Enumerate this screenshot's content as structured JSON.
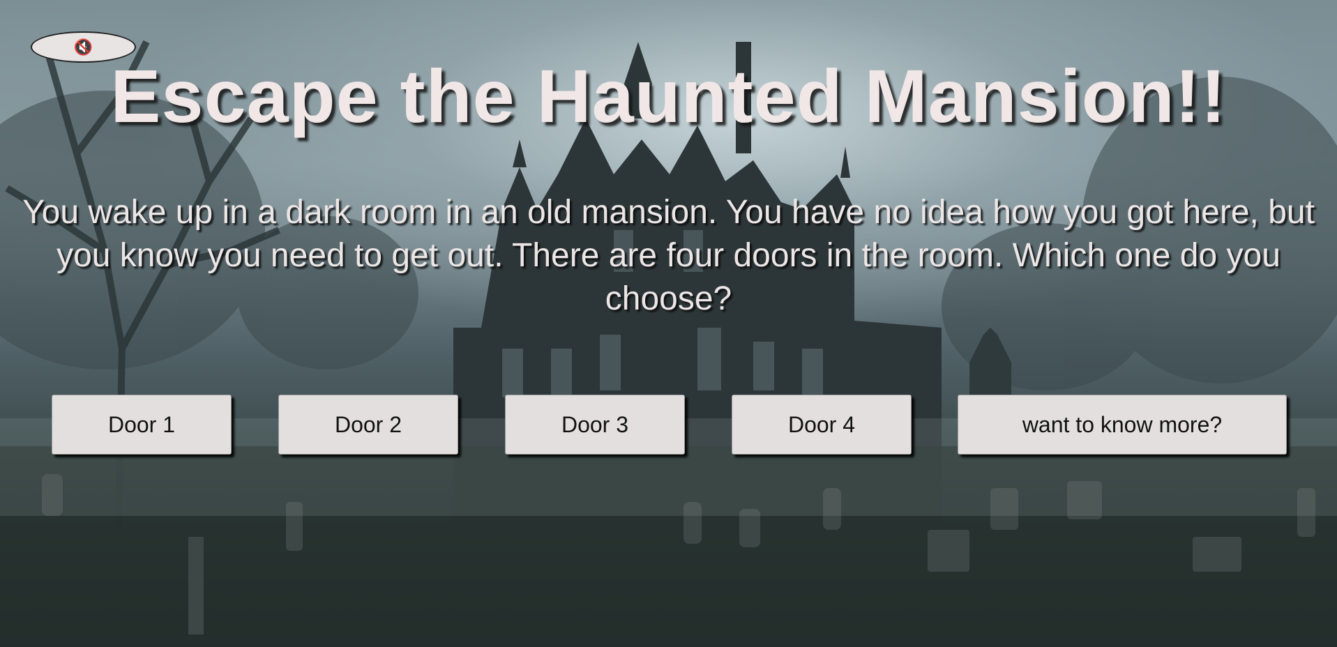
{
  "mute_button": {
    "icon": "speaker-muted-icon",
    "glyph": "🔇"
  },
  "title": "Escape the Haunted Mansion!!",
  "story": "You wake up in a dark room in an old mansion. You have no idea how you got here, but you know you need to get out. There are four doors in the room. Which one do you choose?",
  "choices": [
    {
      "label": "Door 1"
    },
    {
      "label": "Door 2"
    },
    {
      "label": "Door 3"
    },
    {
      "label": "Door 4"
    },
    {
      "label": "want to know more?"
    }
  ],
  "colors": {
    "title_text": "#f1e7e7",
    "button_bg": "#e3dfdf",
    "scene_dark": "#1f2a28",
    "scene_fog": "#c8d6da"
  }
}
